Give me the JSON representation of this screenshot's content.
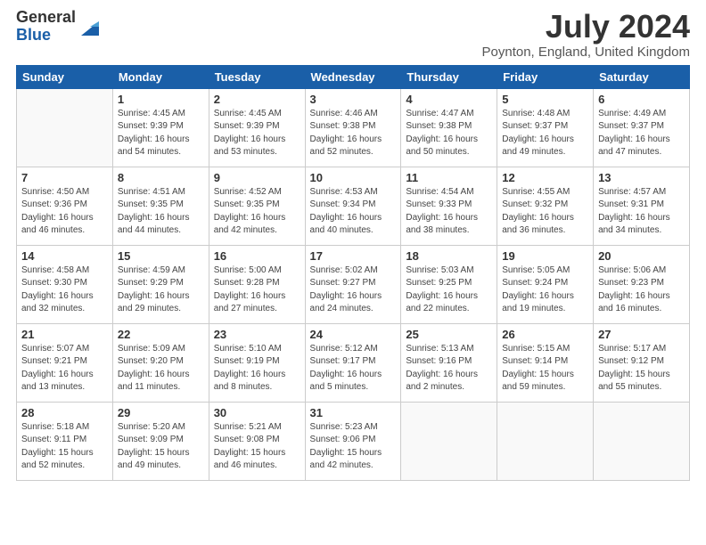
{
  "header": {
    "logo_general": "General",
    "logo_blue": "Blue",
    "title": "July 2024",
    "location": "Poynton, England, United Kingdom"
  },
  "days_of_week": [
    "Sunday",
    "Monday",
    "Tuesday",
    "Wednesday",
    "Thursday",
    "Friday",
    "Saturday"
  ],
  "weeks": [
    [
      {
        "day": "",
        "info": ""
      },
      {
        "day": "1",
        "info": "Sunrise: 4:45 AM\nSunset: 9:39 PM\nDaylight: 16 hours\nand 54 minutes."
      },
      {
        "day": "2",
        "info": "Sunrise: 4:45 AM\nSunset: 9:39 PM\nDaylight: 16 hours\nand 53 minutes."
      },
      {
        "day": "3",
        "info": "Sunrise: 4:46 AM\nSunset: 9:38 PM\nDaylight: 16 hours\nand 52 minutes."
      },
      {
        "day": "4",
        "info": "Sunrise: 4:47 AM\nSunset: 9:38 PM\nDaylight: 16 hours\nand 50 minutes."
      },
      {
        "day": "5",
        "info": "Sunrise: 4:48 AM\nSunset: 9:37 PM\nDaylight: 16 hours\nand 49 minutes."
      },
      {
        "day": "6",
        "info": "Sunrise: 4:49 AM\nSunset: 9:37 PM\nDaylight: 16 hours\nand 47 minutes."
      }
    ],
    [
      {
        "day": "7",
        "info": "Sunrise: 4:50 AM\nSunset: 9:36 PM\nDaylight: 16 hours\nand 46 minutes."
      },
      {
        "day": "8",
        "info": "Sunrise: 4:51 AM\nSunset: 9:35 PM\nDaylight: 16 hours\nand 44 minutes."
      },
      {
        "day": "9",
        "info": "Sunrise: 4:52 AM\nSunset: 9:35 PM\nDaylight: 16 hours\nand 42 minutes."
      },
      {
        "day": "10",
        "info": "Sunrise: 4:53 AM\nSunset: 9:34 PM\nDaylight: 16 hours\nand 40 minutes."
      },
      {
        "day": "11",
        "info": "Sunrise: 4:54 AM\nSunset: 9:33 PM\nDaylight: 16 hours\nand 38 minutes."
      },
      {
        "day": "12",
        "info": "Sunrise: 4:55 AM\nSunset: 9:32 PM\nDaylight: 16 hours\nand 36 minutes."
      },
      {
        "day": "13",
        "info": "Sunrise: 4:57 AM\nSunset: 9:31 PM\nDaylight: 16 hours\nand 34 minutes."
      }
    ],
    [
      {
        "day": "14",
        "info": "Sunrise: 4:58 AM\nSunset: 9:30 PM\nDaylight: 16 hours\nand 32 minutes."
      },
      {
        "day": "15",
        "info": "Sunrise: 4:59 AM\nSunset: 9:29 PM\nDaylight: 16 hours\nand 29 minutes."
      },
      {
        "day": "16",
        "info": "Sunrise: 5:00 AM\nSunset: 9:28 PM\nDaylight: 16 hours\nand 27 minutes."
      },
      {
        "day": "17",
        "info": "Sunrise: 5:02 AM\nSunset: 9:27 PM\nDaylight: 16 hours\nand 24 minutes."
      },
      {
        "day": "18",
        "info": "Sunrise: 5:03 AM\nSunset: 9:25 PM\nDaylight: 16 hours\nand 22 minutes."
      },
      {
        "day": "19",
        "info": "Sunrise: 5:05 AM\nSunset: 9:24 PM\nDaylight: 16 hours\nand 19 minutes."
      },
      {
        "day": "20",
        "info": "Sunrise: 5:06 AM\nSunset: 9:23 PM\nDaylight: 16 hours\nand 16 minutes."
      }
    ],
    [
      {
        "day": "21",
        "info": "Sunrise: 5:07 AM\nSunset: 9:21 PM\nDaylight: 16 hours\nand 13 minutes."
      },
      {
        "day": "22",
        "info": "Sunrise: 5:09 AM\nSunset: 9:20 PM\nDaylight: 16 hours\nand 11 minutes."
      },
      {
        "day": "23",
        "info": "Sunrise: 5:10 AM\nSunset: 9:19 PM\nDaylight: 16 hours\nand 8 minutes."
      },
      {
        "day": "24",
        "info": "Sunrise: 5:12 AM\nSunset: 9:17 PM\nDaylight: 16 hours\nand 5 minutes."
      },
      {
        "day": "25",
        "info": "Sunrise: 5:13 AM\nSunset: 9:16 PM\nDaylight: 16 hours\nand 2 minutes."
      },
      {
        "day": "26",
        "info": "Sunrise: 5:15 AM\nSunset: 9:14 PM\nDaylight: 15 hours\nand 59 minutes."
      },
      {
        "day": "27",
        "info": "Sunrise: 5:17 AM\nSunset: 9:12 PM\nDaylight: 15 hours\nand 55 minutes."
      }
    ],
    [
      {
        "day": "28",
        "info": "Sunrise: 5:18 AM\nSunset: 9:11 PM\nDaylight: 15 hours\nand 52 minutes."
      },
      {
        "day": "29",
        "info": "Sunrise: 5:20 AM\nSunset: 9:09 PM\nDaylight: 15 hours\nand 49 minutes."
      },
      {
        "day": "30",
        "info": "Sunrise: 5:21 AM\nSunset: 9:08 PM\nDaylight: 15 hours\nand 46 minutes."
      },
      {
        "day": "31",
        "info": "Sunrise: 5:23 AM\nSunset: 9:06 PM\nDaylight: 15 hours\nand 42 minutes."
      },
      {
        "day": "",
        "info": ""
      },
      {
        "day": "",
        "info": ""
      },
      {
        "day": "",
        "info": ""
      }
    ]
  ]
}
